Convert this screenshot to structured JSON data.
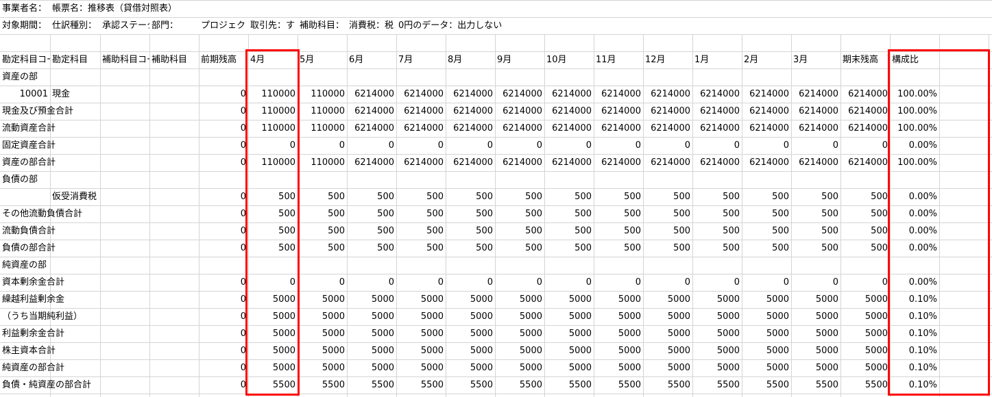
{
  "meta": {
    "row1": [
      "事業者名：",
      "帳票名：推移表（貸借対照表）"
    ],
    "row2": [
      "対象期間：",
      "仕訳種別：",
      "承認ステータス：",
      "部門：",
      "プロジェクト：",
      "取引先：す",
      "補助科目：",
      "消費税：税",
      "0円のデータ：出力しない"
    ]
  },
  "headers": [
    "勘定科目コード",
    "勘定科目",
    "補助科目コード",
    "補助科目",
    "前期残高",
    "4月",
    "5月",
    "6月",
    "7月",
    "8月",
    "9月",
    "10月",
    "11月",
    "12月",
    "1月",
    "2月",
    "3月",
    "期末残高",
    "構成比"
  ],
  "rows": [
    {
      "label": "資産の部"
    },
    {
      "code": "10001",
      "name": "現金",
      "values": [
        "0",
        "110000",
        "110000",
        "6214000",
        "6214000",
        "6214000",
        "6214000",
        "6214000",
        "6214000",
        "6214000",
        "6214000",
        "6214000",
        "6214000",
        "6214000",
        "100.00%"
      ]
    },
    {
      "label": "現金及び預金合計",
      "values": [
        "0",
        "110000",
        "110000",
        "6214000",
        "6214000",
        "6214000",
        "6214000",
        "6214000",
        "6214000",
        "6214000",
        "6214000",
        "6214000",
        "6214000",
        "6214000",
        "100.00%"
      ]
    },
    {
      "label": "流動資産合計",
      "values": [
        "0",
        "110000",
        "110000",
        "6214000",
        "6214000",
        "6214000",
        "6214000",
        "6214000",
        "6214000",
        "6214000",
        "6214000",
        "6214000",
        "6214000",
        "6214000",
        "100.00%"
      ]
    },
    {
      "label": "固定資産合計",
      "values": [
        "0",
        "0",
        "0",
        "0",
        "0",
        "0",
        "0",
        "0",
        "0",
        "0",
        "0",
        "0",
        "0",
        "0",
        "0.00%"
      ]
    },
    {
      "label": "資産の部合計",
      "values": [
        "0",
        "110000",
        "110000",
        "6214000",
        "6214000",
        "6214000",
        "6214000",
        "6214000",
        "6214000",
        "6214000",
        "6214000",
        "6214000",
        "6214000",
        "6214000",
        "100.00%"
      ]
    },
    {
      "label": "負債の部"
    },
    {
      "name": "仮受消費税",
      "values": [
        "0",
        "500",
        "500",
        "500",
        "500",
        "500",
        "500",
        "500",
        "500",
        "500",
        "500",
        "500",
        "500",
        "500",
        "0.00%"
      ]
    },
    {
      "label": "その他流動負債合計",
      "values": [
        "0",
        "500",
        "500",
        "500",
        "500",
        "500",
        "500",
        "500",
        "500",
        "500",
        "500",
        "500",
        "500",
        "500",
        "0.00%"
      ]
    },
    {
      "label": "流動負債合計",
      "values": [
        "0",
        "500",
        "500",
        "500",
        "500",
        "500",
        "500",
        "500",
        "500",
        "500",
        "500",
        "500",
        "500",
        "500",
        "0.00%"
      ]
    },
    {
      "label": "負債の部合計",
      "values": [
        "0",
        "500",
        "500",
        "500",
        "500",
        "500",
        "500",
        "500",
        "500",
        "500",
        "500",
        "500",
        "500",
        "500",
        "0.00%"
      ]
    },
    {
      "label": "純資産の部"
    },
    {
      "label": "資本剰余金合計",
      "values": [
        "0",
        "0",
        "0",
        "0",
        "0",
        "0",
        "0",
        "0",
        "0",
        "0",
        "0",
        "0",
        "0",
        "0",
        "0.00%"
      ]
    },
    {
      "label": "繰越利益剰余金",
      "values": [
        "0",
        "5000",
        "5000",
        "5000",
        "5000",
        "5000",
        "5000",
        "5000",
        "5000",
        "5000",
        "5000",
        "5000",
        "5000",
        "5000",
        "0.10%"
      ]
    },
    {
      "label": "（うち当期純利益）",
      "values": [
        "0",
        "5000",
        "5000",
        "5000",
        "5000",
        "5000",
        "5000",
        "5000",
        "5000",
        "5000",
        "5000",
        "5000",
        "5000",
        "5000",
        "0.10%"
      ]
    },
    {
      "label": "利益剰余金合計",
      "values": [
        "0",
        "5000",
        "5000",
        "5000",
        "5000",
        "5000",
        "5000",
        "5000",
        "5000",
        "5000",
        "5000",
        "5000",
        "5000",
        "5000",
        "0.10%"
      ]
    },
    {
      "label": "株主資本合計",
      "values": [
        "0",
        "5000",
        "5000",
        "5000",
        "5000",
        "5000",
        "5000",
        "5000",
        "5000",
        "5000",
        "5000",
        "5000",
        "5000",
        "5000",
        "0.10%"
      ]
    },
    {
      "label": "純資産の部合計",
      "values": [
        "0",
        "5000",
        "5000",
        "5000",
        "5000",
        "5000",
        "5000",
        "5000",
        "5000",
        "5000",
        "5000",
        "5000",
        "5000",
        "5000",
        "0.10%"
      ]
    },
    {
      "label": "負債・純資産の部合計",
      "values": [
        "0",
        "5500",
        "5500",
        "5500",
        "5500",
        "5500",
        "5500",
        "5500",
        "5500",
        "5500",
        "5500",
        "5500",
        "5500",
        "5500",
        "0.10%"
      ]
    }
  ],
  "colors": {
    "highlight": "#ff0000",
    "grid": "#d4d4d4"
  }
}
